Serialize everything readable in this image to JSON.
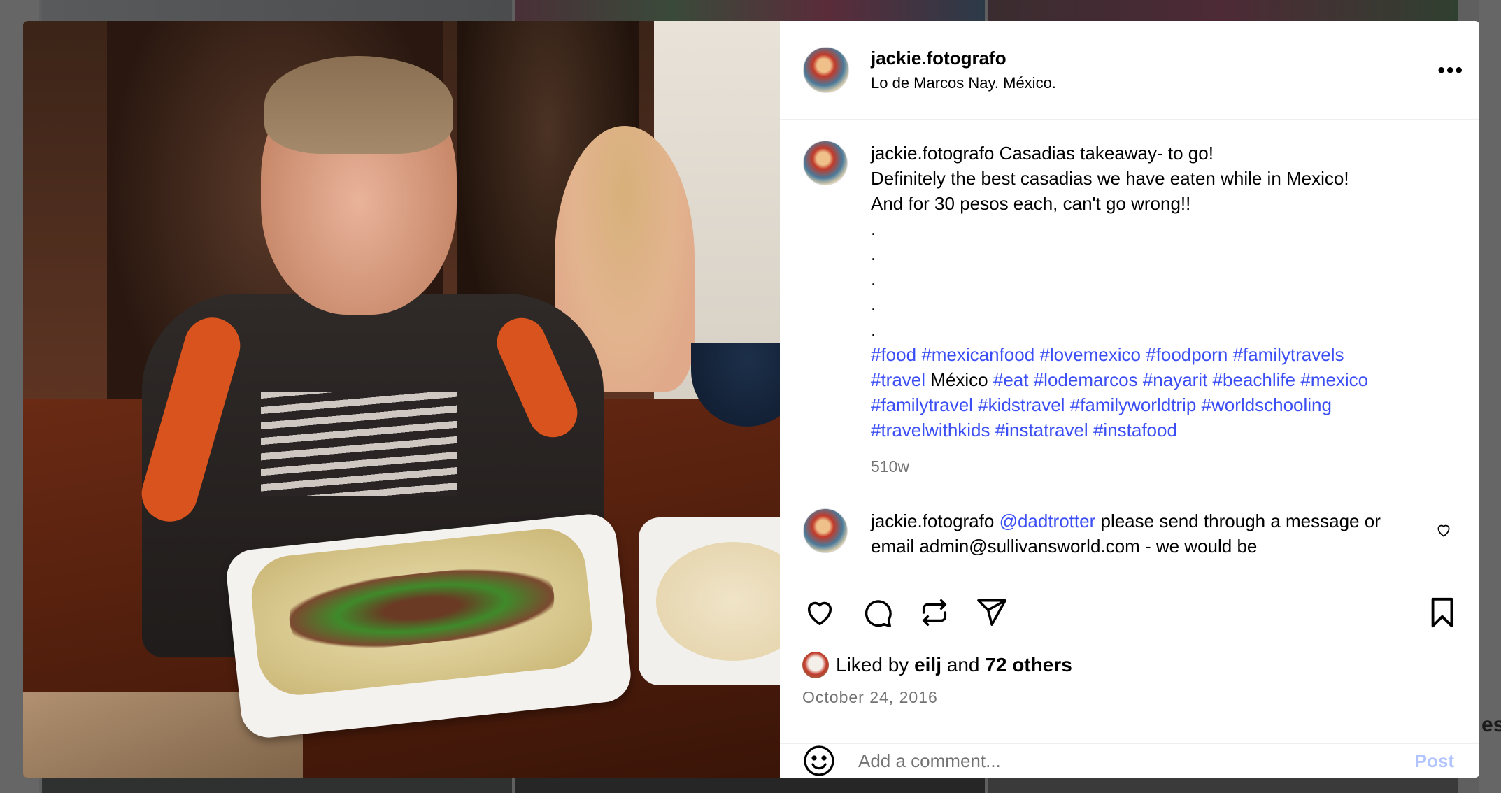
{
  "post": {
    "username": "jackie.fotografo",
    "location": "Lo de Marcos Nay. México.",
    "caption": {
      "username": "jackie.fotografo",
      "lines": [
        "Casadias takeaway- to go!",
        "Definitely the best casadias we have eaten while in Mexico!",
        "And for 30 pesos each, can't go wrong!!"
      ],
      "dots": [
        ".",
        ".",
        ".",
        ".",
        "."
      ],
      "hashtags_line1": [
        "#food",
        "#mexicanfood",
        "#lovemexico",
        "#foodporn",
        "#familytravels"
      ],
      "hashtags_line2_a": "#travel",
      "plain_word": "México",
      "hashtags_line2_b": [
        "#eat",
        "#lodemarcos",
        "#nayarit",
        "#beachlife",
        "#mexico"
      ],
      "hashtags_line3": [
        "#familytravel",
        "#kidstravel",
        "#familyworldtrip",
        "#worldschooling"
      ],
      "hashtags_line4": [
        "#travelwithkids",
        "#instatravel",
        "#instafood"
      ],
      "age": "510w"
    },
    "comment": {
      "username": "jackie.fotografo",
      "mention": "@dadtrotter",
      "text": "please send through a message or email admin@sullivansworld.com - we would be"
    },
    "likes": {
      "prefix": "Liked by",
      "user": "eilj",
      "conjunction": "and",
      "others": "72 others"
    },
    "date": "October 24, 2016",
    "add_comment_placeholder": "Add a comment...",
    "post_button": "Post",
    "icons": {
      "more": "more-options-icon",
      "like": "heart-icon",
      "comment": "comment-bubble-icon",
      "repost": "repost-icon",
      "share": "send-icon",
      "save": "bookmark-icon",
      "emoji": "emoji-icon"
    }
  },
  "backdrop": {
    "glimpse_text": "es"
  },
  "colors": {
    "link": "#3b4ef3",
    "muted": "#737373",
    "post_button": "#b2c4ff"
  }
}
